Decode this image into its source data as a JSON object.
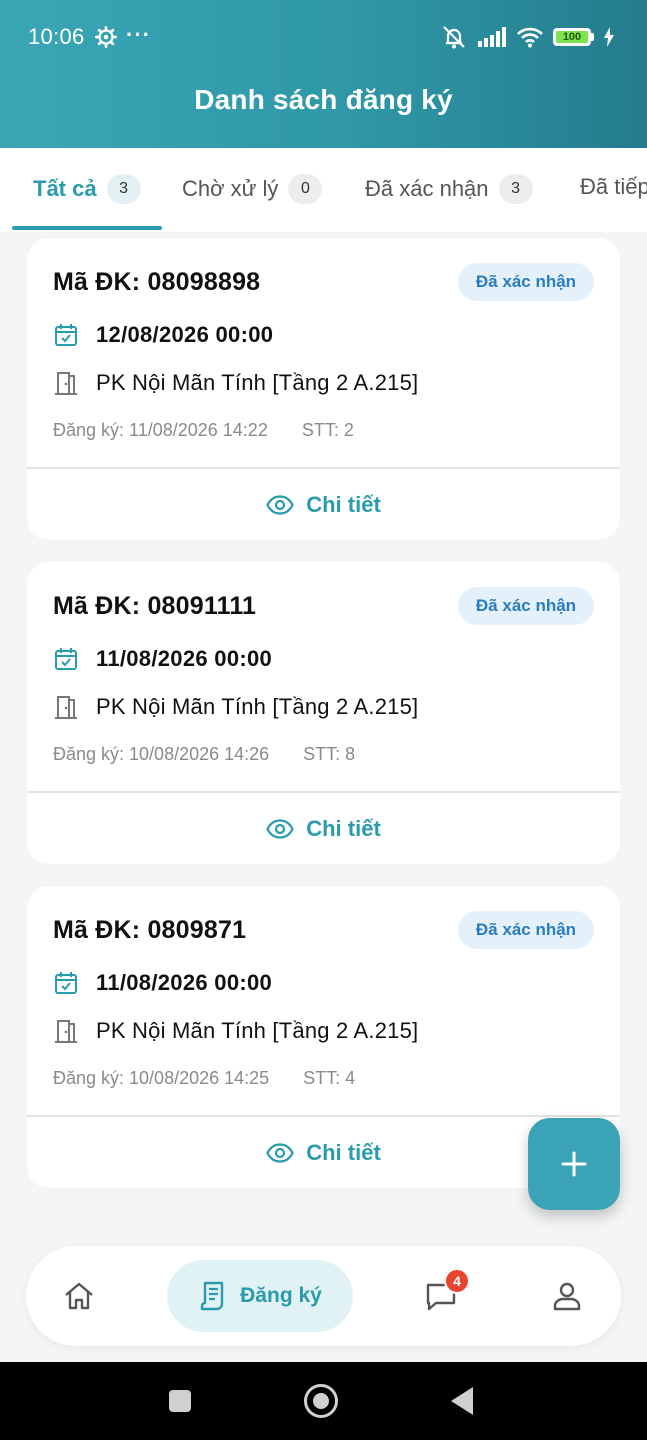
{
  "status_bar": {
    "time": "10:06",
    "dots": "···",
    "battery": "100"
  },
  "header": {
    "title": "Danh sách đăng ký"
  },
  "tabs": [
    {
      "label": "Tất cả",
      "count": "3",
      "active": true
    },
    {
      "label": "Chờ xử lý",
      "count": "0"
    },
    {
      "label": "Đã xác nhận",
      "count": "3"
    },
    {
      "label": "Đã tiếp"
    }
  ],
  "cards": [
    {
      "code": "Mã ĐK: 08098898",
      "status": "Đã xác nhận",
      "date": "12/08/2026 00:00",
      "room": "PK Nội Mãn Tính  [Tầng 2  A.215]",
      "registered": "Đăng ký: 11/08/2026 14:22",
      "stt": "STT: 2",
      "detail": "Chi tiết"
    },
    {
      "code": "Mã ĐK: 08091111",
      "status": "Đã xác nhận",
      "date": "11/08/2026 00:00",
      "room": "PK Nội Mãn Tính  [Tầng 2  A.215]",
      "registered": "Đăng ký: 10/08/2026 14:26",
      "stt": "STT: 8",
      "detail": "Chi tiết"
    },
    {
      "code": "Mã ĐK: 0809871",
      "status": "Đã xác nhận",
      "date": "11/08/2026 00:00",
      "room": "PK Nội Mãn Tính  [Tầng 2  A.215]",
      "registered": "Đăng ký: 10/08/2026 14:25",
      "stt": "STT: 4",
      "detail": "Chi tiết"
    }
  ],
  "fab": {
    "icon": "plus-icon"
  },
  "bottom_nav": {
    "items": [
      {
        "icon": "home-icon"
      },
      {
        "icon": "register-icon",
        "label": "Đăng ký",
        "active": true
      },
      {
        "icon": "chat-icon",
        "badge": "4"
      },
      {
        "icon": "profile-icon"
      }
    ]
  },
  "colors": {
    "primary": "#2a9aad",
    "header_start": "#3aa6b6",
    "header_end": "#237c8c",
    "status_pill_bg": "#e4f1fb",
    "status_pill_text": "#2a7dc0",
    "badge_red": "#e8442f"
  }
}
